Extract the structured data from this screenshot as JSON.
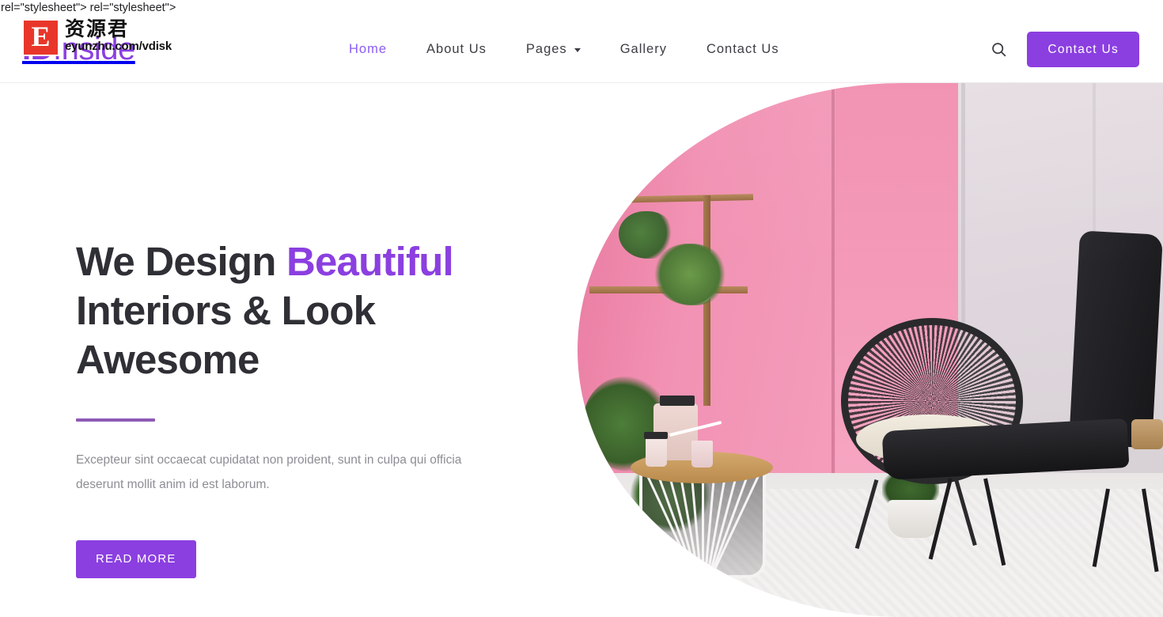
{
  "page": {
    "leaked_markup_text": "rel=\"stylesheet\"> rel=\"stylesheet\">"
  },
  "colors": {
    "brand_purple": "#8b3fe0",
    "nav_active": "#8b5cf6",
    "heading": "#2f3035",
    "body_text": "#8d8d95",
    "rule": "#8e5bb5",
    "watermark_red": "#e8372a"
  },
  "header": {
    "brand": {
      "name": "ID Inside",
      "word_one": "ID",
      "word_two": "Inside"
    },
    "watermark": {
      "badge_letter": "E",
      "chinese": "资源君",
      "url": "eyunzhu.com/vdisk"
    },
    "nav": [
      {
        "label": "Home",
        "active": true,
        "has_dropdown": false,
        "name": "nav-home"
      },
      {
        "label": "About Us",
        "active": false,
        "has_dropdown": false,
        "name": "nav-about-us"
      },
      {
        "label": "Pages",
        "active": false,
        "has_dropdown": true,
        "name": "nav-pages"
      },
      {
        "label": "Gallery",
        "active": false,
        "has_dropdown": false,
        "name": "nav-gallery"
      },
      {
        "label": "Contact Us",
        "active": false,
        "has_dropdown": false,
        "name": "nav-contact-us"
      }
    ],
    "search_icon": "search-icon",
    "cta_label": "Contact Us"
  },
  "hero": {
    "title_line1_plain": "We Design ",
    "title_line1_accent": "Beautiful",
    "title_line2": "Interiors & Look",
    "title_line3": "Awesome",
    "paragraph": "Excepteur sint occaecat cupidatat non proident, sunt in culpa qui officia deserunt mollit anim id est laborum.",
    "button_label": "READ MORE",
    "image_alt": "Pink-walled interior with wall shelves, plants, black round papasan chair, white wire side table and black lounge chair"
  }
}
